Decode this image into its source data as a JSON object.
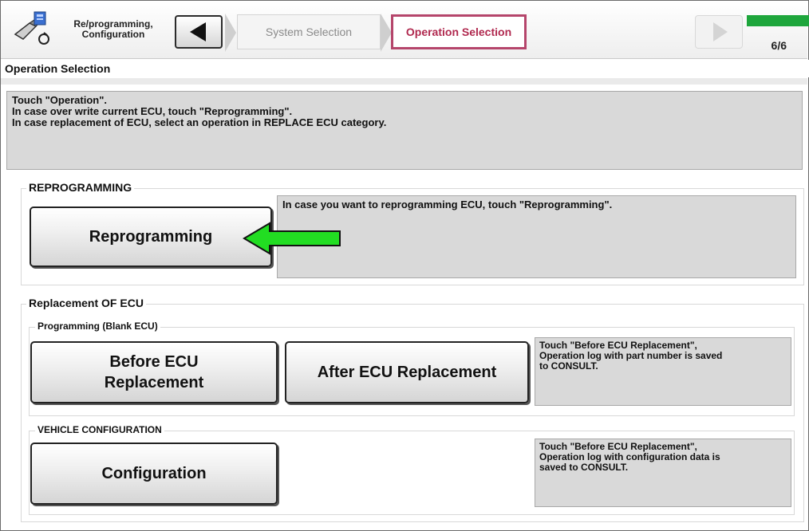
{
  "toolbar": {
    "app_title": "Re/programming, Configuration",
    "steps": [
      "System Selection",
      "Operation Selection"
    ],
    "progress": {
      "label": "6/6",
      "fraction": 1.0,
      "color": "#1ea63c"
    }
  },
  "screen_title": "Operation Selection",
  "instructions": [
    "Touch \"Operation\".",
    "In case over write current ECU, touch \"Reprogramming\".",
    "In case replacement of ECU, select an operation in REPLACE ECU category."
  ],
  "reprogramming": {
    "heading": "REPROGRAMMING",
    "button": "Reprogramming",
    "info": "In case you want to reprogramming ECU, touch \"Reprogramming\"."
  },
  "replacement": {
    "heading": "Replacement OF ECU",
    "programming": {
      "label": "Programming (Blank ECU)",
      "before_button": [
        "Before ECU",
        "Replacement"
      ],
      "after_button": "After ECU Replacement",
      "info": [
        "Touch \"Before ECU Replacement\",",
        "Operation log with part number is saved",
        "to CONSULT."
      ]
    },
    "vehicle_config": {
      "label": "VEHICLE CONFIGURATION",
      "button": "Configuration",
      "info": [
        "Touch \"Before ECU Replacement\",",
        "Operation log with configuration data is",
        "saved to CONSULT."
      ]
    }
  },
  "colors": {
    "active_step": "#b5456b",
    "arrow": "#22dd22"
  },
  "icons": [
    "reprogramming-app-icon",
    "back-arrow-icon",
    "forward-arrow-icon",
    "green-pointer-arrow"
  ]
}
